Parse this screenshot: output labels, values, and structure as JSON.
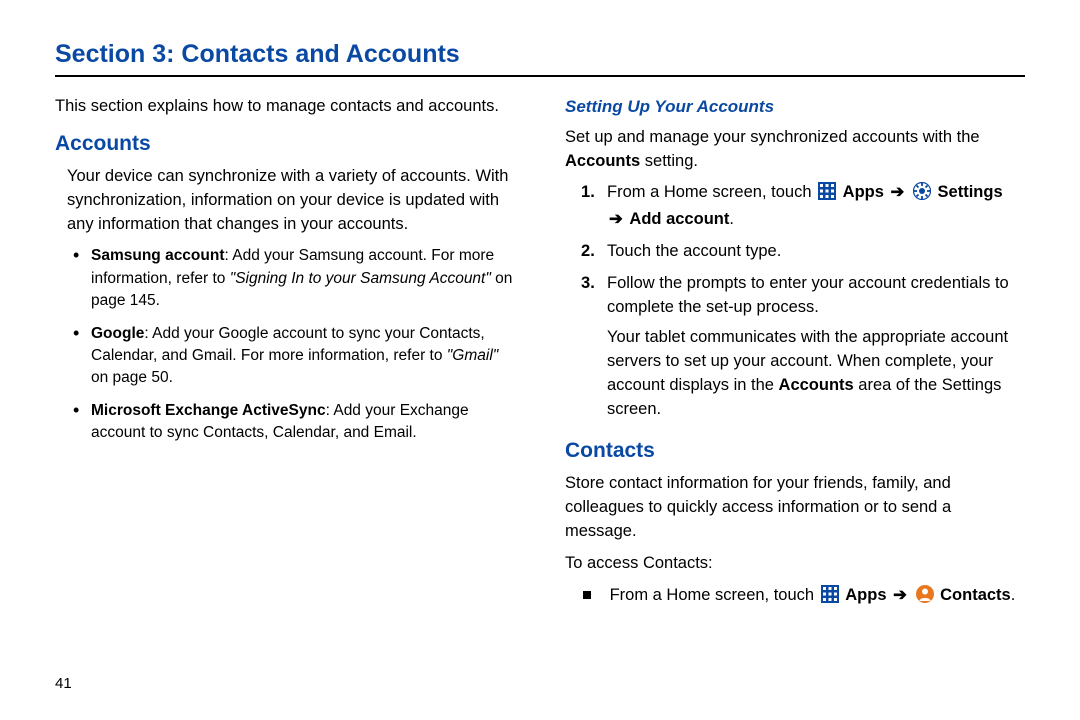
{
  "title": "Section 3: Contacts and Accounts",
  "intro": "This section explains how to manage contacts and accounts.",
  "accounts": {
    "heading": "Accounts",
    "para": "Your device can synchronize with a variety of accounts. With synchronization, information on your device is updated with any information that changes in your accounts.",
    "bullets": [
      {
        "lead": "Samsung account",
        "text": ": Add your Samsung account. For more information, refer to ",
        "ref": "\"Signing In to your Samsung Account\"",
        "tail": " on page 145."
      },
      {
        "lead": "Google",
        "text": ": Add your Google account to sync your Contacts, Calendar, and Gmail. For more information, refer to ",
        "ref": "\"Gmail\"",
        "tail": " on page 50."
      },
      {
        "lead": "Microsoft Exchange ActiveSync",
        "text": ": Add your Exchange account to sync Contacts, Calendar, and Email.",
        "ref": "",
        "tail": ""
      }
    ]
  },
  "setup": {
    "heading": "Setting Up Your Accounts",
    "para1a": "Set up and manage your synchronized accounts with the ",
    "para1b": "Accounts",
    "para1c": " setting.",
    "step1_a": "From a Home screen, touch ",
    "apps_label": "Apps",
    "settings_label": "Settings",
    "add_account_label": "Add account",
    "step2": "Touch the account type.",
    "step3": "Follow the prompts to enter your account credentials to complete the set-up process.",
    "step3_sub_a": "Your tablet communicates with the appropriate account servers to set up your account. When complete, your account displays in the ",
    "step3_sub_b": "Accounts",
    "step3_sub_c": " area of the Settings screen."
  },
  "contacts": {
    "heading": "Contacts",
    "para": "Store contact information for your friends, family, and colleagues to quickly access information or to send a message.",
    "access": "To access Contacts:",
    "step_a": "From a Home screen, touch ",
    "contacts_label": "Contacts"
  },
  "pagenum": "41",
  "arrow": "➔",
  "period": "."
}
